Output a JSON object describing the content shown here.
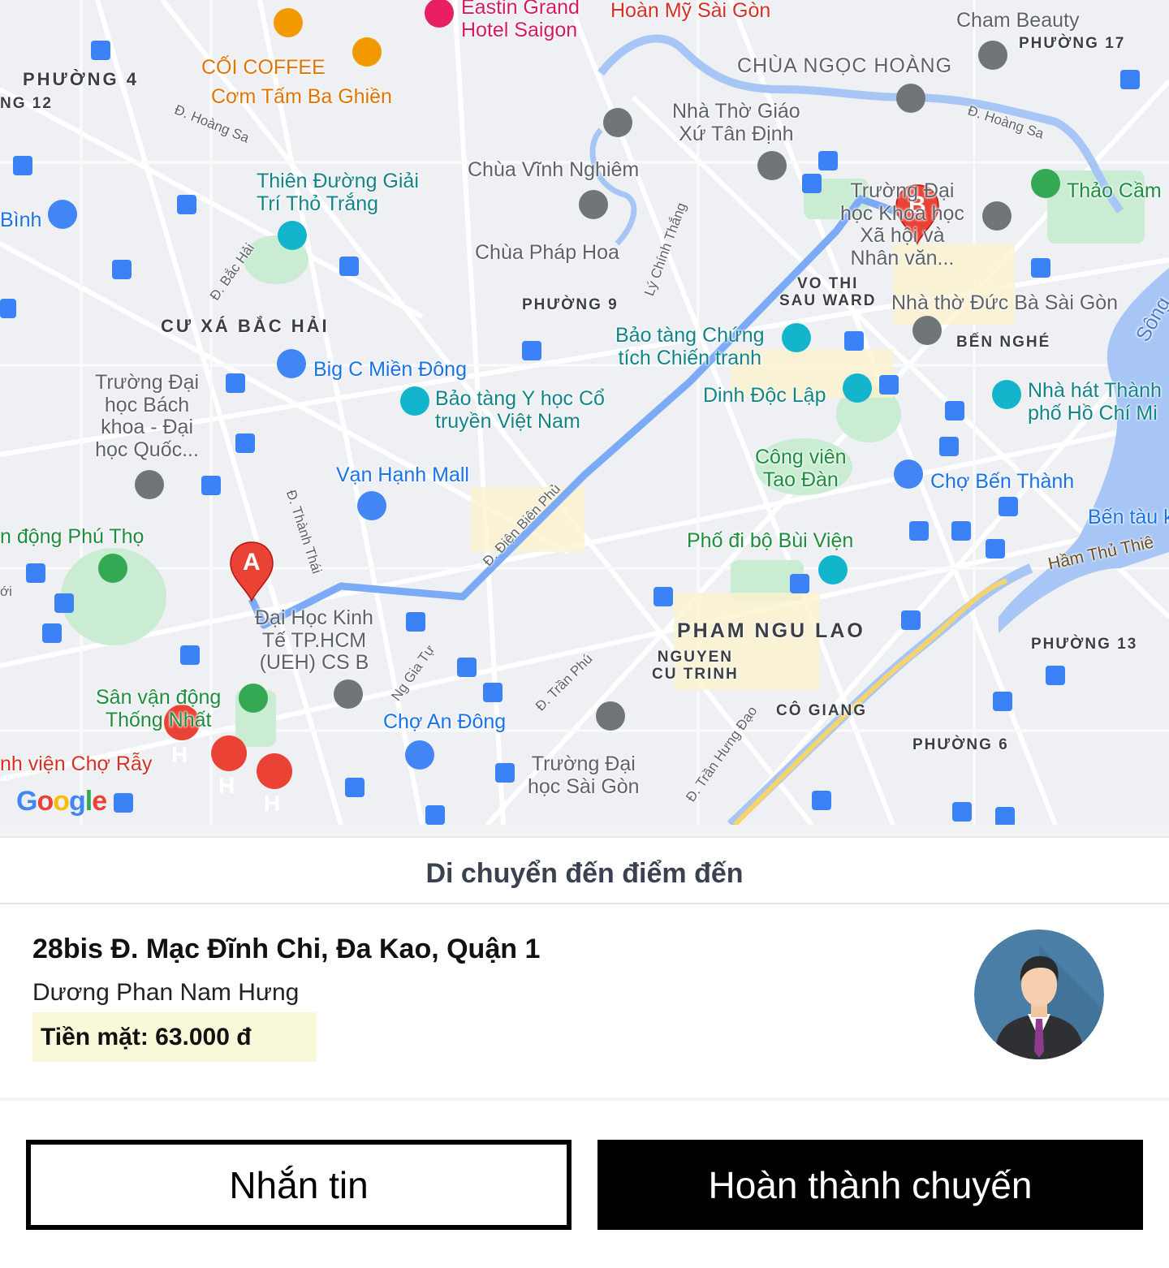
{
  "map": {
    "districts": [
      {
        "key": "phuong4",
        "text": "PHƯỜNG 4"
      },
      {
        "key": "phuong12",
        "text": "NG 12"
      },
      {
        "key": "cuxabachai",
        "text": "CƯ XÁ BẮC HẢI"
      },
      {
        "key": "phuong9",
        "text": "PHƯỜNG 9"
      },
      {
        "key": "vothisau",
        "text": "VO THI\nSAU WARD"
      },
      {
        "key": "bennghe",
        "text": "BẾN NGHÉ"
      },
      {
        "key": "phamngulao",
        "text": "PHAM NGU LAO"
      },
      {
        "key": "nguyencutrinh",
        "text": "NGUYEN\nCU TRINH"
      },
      {
        "key": "cogiang",
        "text": "CÔ GIANG"
      },
      {
        "key": "phuong13",
        "text": "PHƯỜNG 13"
      },
      {
        "key": "phuong6",
        "text": "PHƯỜNG 6"
      },
      {
        "key": "phuong17",
        "text": "PHƯỜNG 17"
      }
    ],
    "places": {
      "eastin": "Eastin Grand\nHotel Saigon",
      "hoanmy": "Hoàn Mỹ Sài Gòn",
      "chambeauty": "Cham Beauty",
      "chuangochoang": "CHÙA NGỌC HOÀNG",
      "coicoffee": "CỐI COFFEE",
      "comtam": "Cơm Tấm Ba Ghiền",
      "nhatho": "Nhà Thờ Giáo\nXứ Tân Định",
      "thienduong": "Thiên Đường Giải\nTrí Thỏ Trắng",
      "chuavinhnghiem": "Chùa Vĩnh Nghiêm",
      "chuaphaphoa": "Chùa Pháp Hoa",
      "truongdaihocxh": "Trường Đại\nhọc Khoa học\nXã hội và\nNhân văn...",
      "thaocam": "Thảo Cầm",
      "binh": "Bình",
      "nhathoducba": "Nhà thờ Đức Bà Sài Gòn",
      "songsg": "Sông",
      "baotangchungtich": "Bảo tàng Chứng\ntích Chiến tranh",
      "bigc": "Big C Miền Đông",
      "truongbachkhoa": "Trường Đại\nhọc Bách\nkhoa - Đại\nhọc Quốc...",
      "baotangyhoc": "Bảo tàng Y học Cổ\ntruyền Việt Nam",
      "dinhdoclap": "Dinh Độc Lập",
      "nhahatthanhpho": "Nhà hát Thành\nphố Hồ Chí Mi",
      "congvientaodan": "Công viên\nTao Đàn",
      "chobenthanh": "Chợ Bến Thành",
      "vanhanhmall": "Vạn Hạnh Mall",
      "dongphutho": "n động Phú Thọ",
      "bentau": "Bến tàu k",
      "phodibo": "Phố đi bộ Bùi Viện",
      "hamthuthiem": "Hầm Thủ Thiê",
      "ueh": "Đại Học Kinh\nTế TP.HCM\n(UEH) CS B",
      "svdthongnhat": "Sân vận động\nThống Nhất",
      "choandong": "Chợ An Đông",
      "truongsaigon": "Trường Đại\nhọc Sài Gòn",
      "benhvienchoray": "nh viện Chợ Rẫy",
      "oi": "ới"
    },
    "streets": {
      "hoangsa1": "Đ. Hoàng Sa",
      "hoangsa2": "Đ. Hoàng Sa",
      "bachai": "Đ. Bắc Hải",
      "lychinhthang": "Lý Chính Thắng",
      "thanhthai": "Đ. Thành Thái",
      "dienbienphu": "Đ. Điện Biên Phủ",
      "nggiatu": "Ng Gia Tự",
      "tranphu": "Đ. Trần Phú",
      "tranhungdao": "Đ. Trần Hưng Đạo"
    },
    "pins": {
      "start": "A",
      "end": "B"
    },
    "hospital_letter": "H",
    "logo": "Google",
    "route_color": "#7baaf7"
  },
  "sheet": {
    "title": "Di chuyển đến điểm đến",
    "address": "28bis Đ. Mạc Đĩnh Chi, Đa Kao, Quận 1",
    "customer_name": "Dương Phan Nam Hưng",
    "payment": "Tiền mặt: 63.000 đ"
  },
  "buttons": {
    "message": "Nhắn tin",
    "complete": "Hoàn thành chuyến"
  }
}
